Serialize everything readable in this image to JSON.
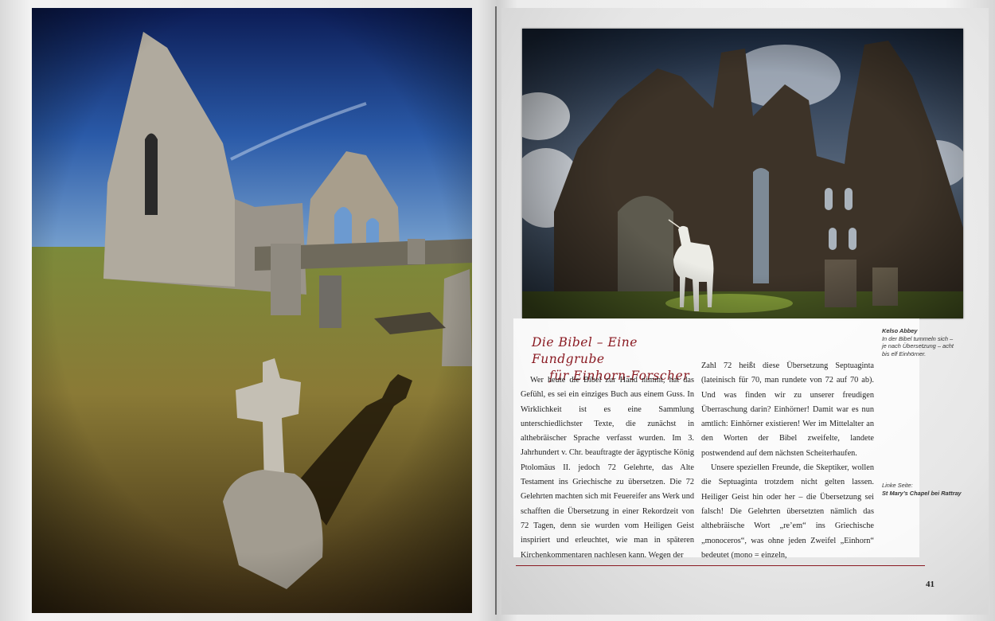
{
  "right_page": {
    "title_line1": "Die Bibel – Eine Fundgrube",
    "title_line2": "für Einhorn-Forscher",
    "col1_para1": "Wer heute die Bibel zur Hand nimmt, hat das Gefühl, es sei ein einziges Buch aus einem Guss. In Wirklichkeit ist es eine Sammlung unterschiedlichster Texte, die zunächst in althebräischer Sprache verfasst wurden. Im 3. Jahrhundert v. Chr. beauftragte der ägyptische König Ptolomäus II. jedoch 72 Gelehrte, das Alte Testament ins Griechische zu übersetzen. Die 72 Gelehrten machten sich mit Feuereifer ans Werk und schafften die Übersetzung in einer Rekordzeit von 72 Tagen, denn sie wurden vom Heiligen Geist inspiriert und erleuchtet, wie man in späteren Kirchenkommentaren nachlesen kann. Wegen der",
    "col2_para1": "Zahl 72 heißt diese Übersetzung Septuaginta (lateinisch für 70, man rundete von 72 auf 70 ab). Und was finden wir zu unserer freudigen Überraschung darin? Einhörner! Damit war es nun amtlich: Einhörner existieren! Wer im Mittelalter an den Worten der Bibel zweifelte, landete postwendend auf dem nächsten Scheiterhaufen.",
    "col2_para2": "Unsere speziellen Freunde, die Skeptiker, wollen die Septuaginta trotzdem nicht gelten lassen. Heiliger Geist hin oder her – die Übersetzung sei falsch! Die Gelehrten übersetzten nämlich das althebräische Wort „re’em“ ins Griechische „monoceros“, was ohne jeden Zweifel „Einhorn“ bedeutet (mono = einzeln,",
    "caption1_title": "Kelso Abbey",
    "caption1_text": "In der Bibel tummeln sich – je nach Übersetzung – acht bis elf Einhörner.",
    "caption2_title": "Linke Seite:",
    "caption2_text": "St Mary’s Chapel bei Rattray",
    "page_number": "41"
  },
  "colors": {
    "accent": "#8a1a22",
    "text": "#222222"
  }
}
